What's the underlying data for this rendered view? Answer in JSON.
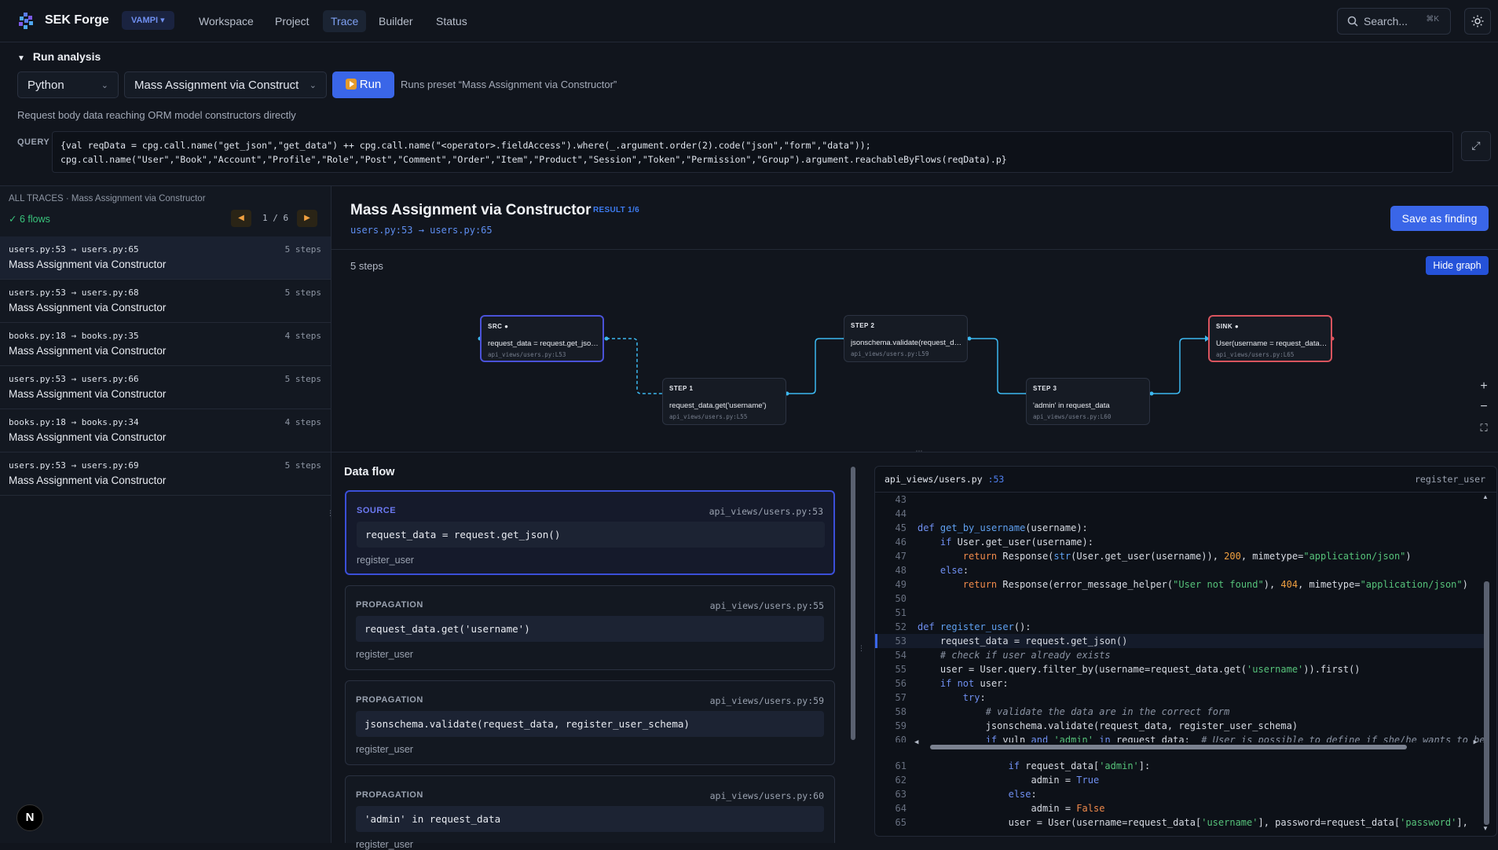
{
  "topbar": {
    "brand": "SEK Forge",
    "project": "VAMPI ▾",
    "nav": [
      "Workspace",
      "Project",
      "Trace",
      "Builder",
      "Status"
    ],
    "active_nav": "Trace",
    "search_label": "Search...",
    "search_shortcut": "⌘K",
    "icons": [
      "logo-icon",
      "search-icon",
      "sun-icon"
    ]
  },
  "run": {
    "toggle": "▼",
    "title": "Run analysis",
    "language": "Python",
    "preset": "Mass Assignment via Construct",
    "run_label": "Run",
    "preset_note": "Runs preset “Mass Assignment via Constructor”",
    "description": "Request body data reaching ORM model constructors directly",
    "query_label": "QUERY",
    "query_lines": [
      "{val reqData = cpg.call.name(\"get_json\",\"get_data\") ++ cpg.call.name(\"<operator>.fieldAccess\").where(_.argument.order(2).code(\"json\",\"form\",\"data\"));",
      "cpg.call.name(\"User\",\"Book\",\"Account\",\"Profile\",\"Role\",\"Post\",\"Comment\",\"Order\",\"Item\",\"Product\",\"Session\",\"Token\",\"Permission\",\"Group\").argument.reachableByFlows(reqData).p}"
    ],
    "expand_icon": "⤢"
  },
  "traces": {
    "header": "ALL TRACES · Mass Assignment via Constructor",
    "flow_count": "✓ 6 flows",
    "pager": "1 / 6",
    "prev": "◀",
    "next": "▶",
    "items": [
      {
        "loc": "users.py:53 → users.py:65",
        "steps": "5 steps",
        "name": "Mass Assignment via Constructor",
        "selected": true
      },
      {
        "loc": "users.py:53 → users.py:68",
        "steps": "5 steps",
        "name": "Mass Assignment via Constructor"
      },
      {
        "loc": "books.py:18 → books.py:35",
        "steps": "4 steps",
        "name": "Mass Assignment via Constructor"
      },
      {
        "loc": "users.py:53 → users.py:66",
        "steps": "5 steps",
        "name": "Mass Assignment via Constructor"
      },
      {
        "loc": "books.py:18 → books.py:34",
        "steps": "4 steps",
        "name": "Mass Assignment via Constructor"
      },
      {
        "loc": "users.py:53 → users.py:69",
        "steps": "5 steps",
        "name": "Mass Assignment via Constructor"
      }
    ],
    "avatar": "N"
  },
  "result": {
    "title": "Mass Assignment via Constructor",
    "badge": "RESULT 1/6",
    "loc": "users.py:53 → users.py:65",
    "save_label": "Save as finding",
    "steps_label": "5 steps",
    "hide_graph": "Hide graph"
  },
  "graph": {
    "nodes": [
      {
        "title": "SRC ●",
        "code": "request_data = request.get_json()",
        "loc": "api_views/users.py:L53",
        "kind": "src"
      },
      {
        "title": "STEP 1",
        "code": "request_data.get('username')",
        "loc": "api_views/users.py:L55",
        "kind": "step"
      },
      {
        "title": "STEP 2",
        "code": "jsonschema.validate(request_data, register_user_schema)",
        "loc": "api_views/users.py:L59",
        "kind": "step"
      },
      {
        "title": "STEP 3",
        "code": "'admin' in request_data",
        "loc": "api_views/users.py:L60",
        "kind": "step"
      },
      {
        "title": "SINK ●",
        "code": "User(username = request_data['username'], ...)",
        "loc": "api_views/users.py:L65",
        "kind": "sink"
      }
    ],
    "zoom_in": "+",
    "zoom_out": "−",
    "fit": "⛶"
  },
  "dataflow": {
    "title": "Data flow",
    "cards": [
      {
        "kind": "SOURCE",
        "loc": "api_views/users.py:53",
        "code": "request_data = request.get_json()",
        "func": "register_user"
      },
      {
        "kind": "PROPAGATION",
        "loc": "api_views/users.py:55",
        "code": "request_data.get('username')",
        "func": "register_user"
      },
      {
        "kind": "PROPAGATION",
        "loc": "api_views/users.py:59",
        "code": "jsonschema.validate(request_data, register_user_schema)",
        "func": "register_user"
      },
      {
        "kind": "PROPAGATION",
        "loc": "api_views/users.py:60",
        "code": "'admin' in request_data",
        "func": "register_user"
      }
    ]
  },
  "code": {
    "file": "api_views/users.py",
    "line_ref": ":53",
    "function": "register_user",
    "highlight": 53
  }
}
